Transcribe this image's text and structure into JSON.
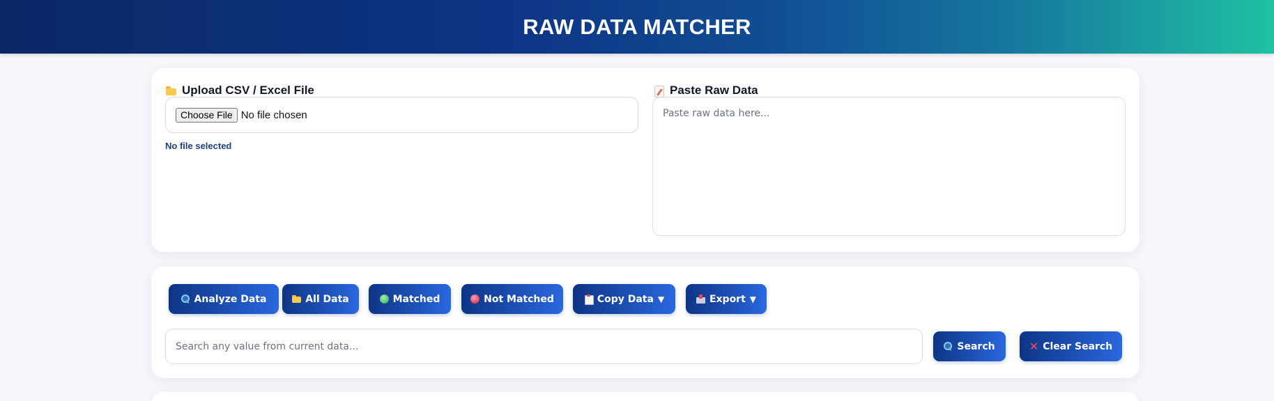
{
  "header": {
    "title": "RAW DATA MATCHER"
  },
  "upload": {
    "title": "Upload CSV / Excel File",
    "choose_label": "Choose File",
    "no_file_chosen": "No file chosen",
    "status": "No file selected"
  },
  "paste": {
    "title": "Paste Raw Data",
    "placeholder": "Paste raw data here..."
  },
  "actions": {
    "analyze": "Analyze Data",
    "all_data": "All Data",
    "matched": "Matched",
    "not_matched": "Not Matched",
    "copy_data": "Copy Data",
    "export": "Export",
    "dropdown_caret": "▼"
  },
  "search": {
    "placeholder": "Search any value from current data...",
    "search_label": "Search",
    "clear_label": "Clear Search"
  },
  "icons": {
    "upload_title": "folder-icon",
    "paste_title": "memo-icon",
    "analyze": "magnifier-icon",
    "all_data": "folder-icon",
    "matched": "green-circle-icon",
    "not_matched": "red-circle-icon",
    "copy_data": "clipboard-icon",
    "export": "outbox-icon",
    "search": "magnifier-icon",
    "clear": "cross-mark-icon"
  },
  "colors": {
    "header_gradient_start": "#0b2866",
    "header_gradient_end": "#1fc1a3",
    "button_gradient_start": "#0d3585",
    "button_gradient_end": "#2a67df",
    "file_status": "#1b3f7a"
  }
}
